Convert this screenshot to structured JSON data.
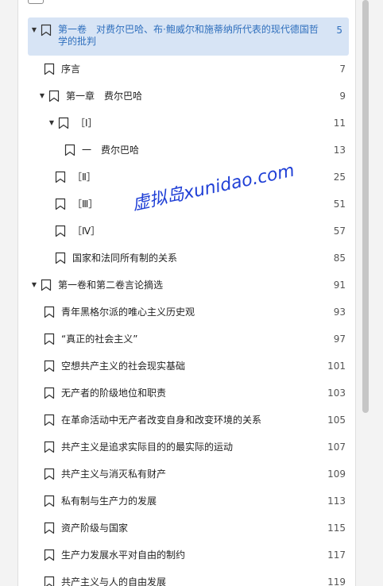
{
  "watermark": "虚拟岛xunidao.com",
  "outline": [
    {
      "label": "第一卷　对费尔巴哈、布·鲍威尔和施蒂纳所代表的现代德国哲学的批判",
      "page": "5",
      "level": 0,
      "toggle": "▼",
      "selected": true
    },
    {
      "label": "序言",
      "page": "7",
      "level": 1,
      "toggle": ""
    },
    {
      "label": "第一章　费尔巴哈",
      "page": "9",
      "level": 1,
      "toggle": "▼"
    },
    {
      "label": "［Ⅰ］",
      "page": "11",
      "level": 2,
      "toggle": "▼"
    },
    {
      "label": "一　费尔巴哈",
      "page": "13",
      "level": 3,
      "toggle": ""
    },
    {
      "label": "［Ⅱ］",
      "page": "25",
      "level": 2,
      "toggle": ""
    },
    {
      "label": "［Ⅲ］",
      "page": "51",
      "level": 2,
      "toggle": ""
    },
    {
      "label": "［Ⅳ］",
      "page": "57",
      "level": 2,
      "toggle": ""
    },
    {
      "label": "国家和法同所有制的关系",
      "page": "85",
      "level": 2,
      "toggle": ""
    },
    {
      "label": "第一卷和第二卷言论摘选",
      "page": "91",
      "level": 0,
      "toggle": "▼"
    },
    {
      "label": "青年黑格尔派的唯心主义历史观",
      "page": "93",
      "level": 1,
      "toggle": ""
    },
    {
      "label": "“真正的社会主义”",
      "page": "97",
      "level": 1,
      "toggle": ""
    },
    {
      "label": "空想共产主义的社会现实基础",
      "page": "101",
      "level": 1,
      "toggle": ""
    },
    {
      "label": "无产者的阶级地位和职责",
      "page": "103",
      "level": 1,
      "toggle": ""
    },
    {
      "label": "在革命活动中无产者改变自身和改变环境的关系",
      "page": "105",
      "level": 1,
      "toggle": ""
    },
    {
      "label": "共产主义是追求实际目的的最实际的运动",
      "page": "107",
      "level": 1,
      "toggle": ""
    },
    {
      "label": "共产主义与消灭私有财产",
      "page": "109",
      "level": 1,
      "toggle": ""
    },
    {
      "label": "私有制与生产力的发展",
      "page": "113",
      "level": 1,
      "toggle": ""
    },
    {
      "label": "资产阶级与国家",
      "page": "115",
      "level": 1,
      "toggle": ""
    },
    {
      "label": "生产力发展水平对自由的制约",
      "page": "117",
      "level": 1,
      "toggle": ""
    },
    {
      "label": "共产主义与人的自由发展",
      "page": "119",
      "level": 1,
      "toggle": ""
    }
  ]
}
